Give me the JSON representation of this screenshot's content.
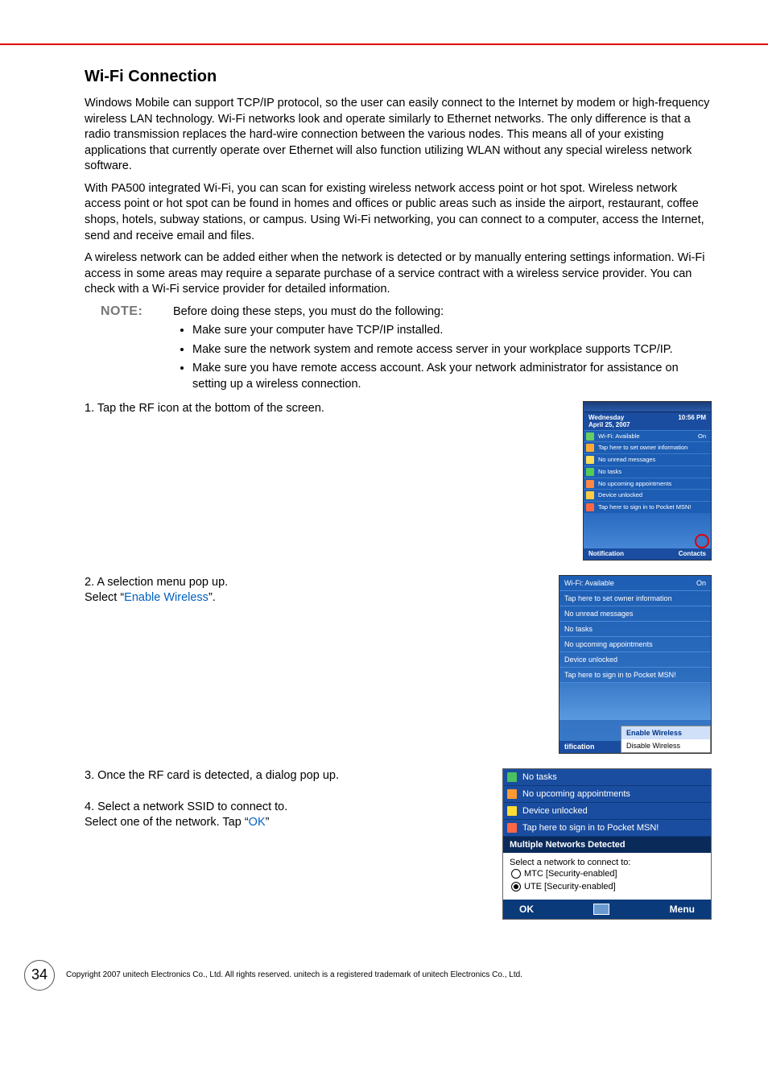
{
  "heading": "Wi-Fi Connection",
  "para1": "Windows Mobile can support TCP/IP protocol, so the user can easily connect to the Internet by modem or high-frequency wireless LAN technology. Wi-Fi networks look and operate similarly to Ethernet networks. The only difference is that a radio transmission replaces the hard-wire connection between the various nodes. This means all of your existing applications that currently operate over Ethernet will also function utilizing WLAN without any special wireless network software.",
  "para2": "With PA500 integrated Wi-Fi, you can scan for existing wireless network access point or hot spot. Wireless network access point or hot spot can be found in homes and offices or public areas such as inside the airport, restaurant, coffee shops, hotels, subway stations, or campus. Using Wi-Fi networking, you can connect to a computer, access the Internet, send and receive email and files.",
  "para3": "A wireless network can be added either when the network is detected or by manually entering settings information. Wi-Fi access in some areas may require a separate purchase of a service contract with a wireless service provider. You can check with a Wi-Fi service provider for detailed information.",
  "note_label": "NOTE:",
  "note_intro": "Before doing these steps, you must do the following:",
  "note_items": [
    "Make sure your computer have TCP/IP installed.",
    "Make sure the network system and remote access server in your workplace supports TCP/IP.",
    "Make sure you have remote access account. Ask your network administrator for assistance on setting up a wireless connection."
  ],
  "step1": "1. Tap the RF icon at the bottom of the screen.",
  "step2_a": "2. A selection menu pop up.",
  "step2_b": "Select “",
  "step2_link": "Enable Wireless",
  "step2_c": "”.",
  "step3": "3. Once the RF card is detected, a dialog pop up.",
  "step4_a": "4. Select a network SSID to connect to.",
  "step4_b": "Select one of the network. Tap “",
  "step4_link": "OK",
  "step4_c": "”",
  "screen1": {
    "day": "Wednesday",
    "date": "April 25, 2007",
    "time": "10:56 PM",
    "wifi": "Wi-Fi: Available",
    "wifi_status": "On",
    "owner": "Tap here to set owner information",
    "messages": "No unread messages",
    "tasks": "No tasks",
    "appts": "No upcoming appointments",
    "locked": "Device unlocked",
    "msn": "Tap here to sign in to Pocket MSN!",
    "left_sk": "Notification",
    "right_sk": "Contacts"
  },
  "screen2": {
    "wifi": "Wi-Fi: Available",
    "wifi_status": "On",
    "owner": "Tap here to set owner information",
    "messages": "No unread messages",
    "tasks": "No tasks",
    "appts": "No upcoming appointments",
    "locked": "Device unlocked",
    "msn": "Tap here to sign in to Pocket MSN!",
    "menu1": "Enable Wireless",
    "menu2": "Disable Wireless",
    "left_sk": "tification"
  },
  "screen3": {
    "tasks": "No tasks",
    "appts": "No upcoming appointments",
    "locked": "Device unlocked",
    "msn": "Tap here to sign in to Pocket MSN!",
    "dialog_title": "Multiple Networks Detected",
    "prompt": "Select a network to connect to:",
    "net1": "MTC [Security-enabled]",
    "net2": "UTE [Security-enabled]",
    "ok": "OK",
    "menu": "Menu"
  },
  "page_number": "34",
  "copyright": "Copyright 2007 unitech Electronics Co., Ltd. All rights reserved. unitech is a registered trademark of unitech Electronics Co., Ltd."
}
